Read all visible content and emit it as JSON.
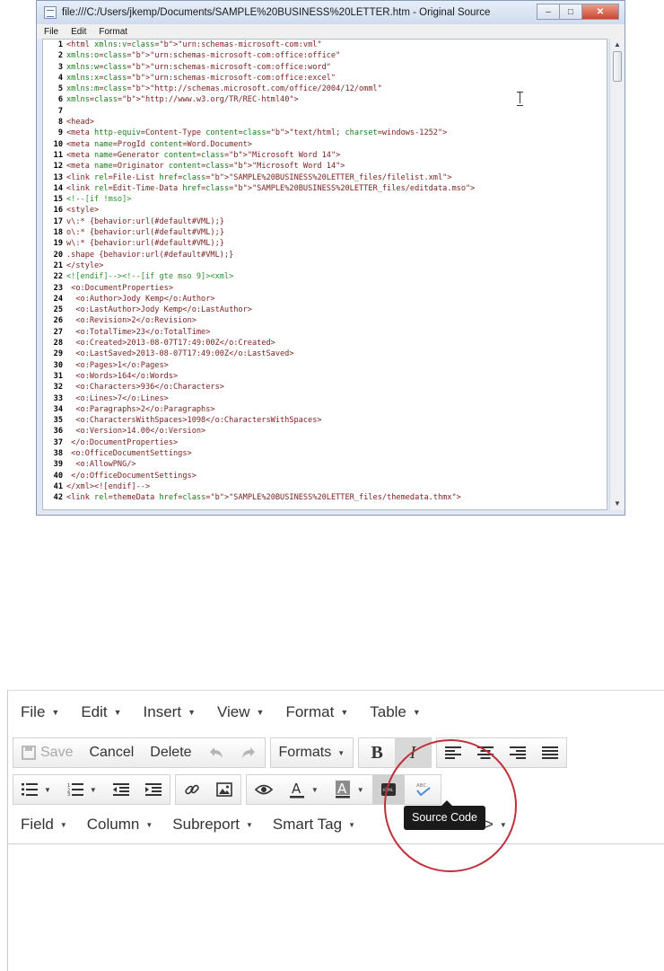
{
  "source_window": {
    "title": "file:///C:/Users/jkemp/Documents/SAMPLE%20BUSINESS%20LETTER.htm - Original Source",
    "menu": [
      "File",
      "Edit",
      "Format"
    ],
    "controls": {
      "minimize": "–",
      "maximize": "□",
      "close": "✕"
    },
    "lines": [
      {
        "n": "1",
        "t": "<html xmlns:v=\"urn:schemas-microsoft-com:vml\""
      },
      {
        "n": "2",
        "t": "xmlns:o=\"urn:schemas-microsoft-com:office:office\""
      },
      {
        "n": "3",
        "t": "xmlns:w=\"urn:schemas-microsoft-com:office:word\""
      },
      {
        "n": "4",
        "t": "xmlns:x=\"urn:schemas-microsoft-com:office:excel\""
      },
      {
        "n": "5",
        "t": "xmlns:m=\"http://schemas.microsoft.com/office/2004/12/omml\""
      },
      {
        "n": "6",
        "t": "xmlns=\"http://www.w3.org/TR/REC-html40\">"
      },
      {
        "n": "7",
        "t": ""
      },
      {
        "n": "8",
        "t": "<head>"
      },
      {
        "n": "9",
        "t": "<meta http-equiv=Content-Type content=\"text/html; charset=windows-1252\">"
      },
      {
        "n": "10",
        "t": "<meta name=ProgId content=Word.Document>"
      },
      {
        "n": "11",
        "t": "<meta name=Generator content=\"Microsoft Word 14\">"
      },
      {
        "n": "12",
        "t": "<meta name=Originator content=\"Microsoft Word 14\">"
      },
      {
        "n": "13",
        "t": "<link rel=File-List href=\"SAMPLE%20BUSINESS%20LETTER_files/filelist.xml\">"
      },
      {
        "n": "14",
        "t": "<link rel=Edit-Time-Data href=\"SAMPLE%20BUSINESS%20LETTER_files/editdata.mso\">"
      },
      {
        "n": "15",
        "t": "<!--[if !mso]>"
      },
      {
        "n": "16",
        "t": "<style>"
      },
      {
        "n": "17",
        "t": "v\\:* {behavior:url(#default#VML);}"
      },
      {
        "n": "18",
        "t": "o\\:* {behavior:url(#default#VML);}"
      },
      {
        "n": "19",
        "t": "w\\:* {behavior:url(#default#VML);}"
      },
      {
        "n": "20",
        "t": ".shape {behavior:url(#default#VML);}"
      },
      {
        "n": "21",
        "t": "</style>"
      },
      {
        "n": "22",
        "t": "<![endif]--><!--[if gte mso 9]><xml>"
      },
      {
        "n": "23",
        "t": " <o:DocumentProperties>"
      },
      {
        "n": "24",
        "t": "  <o:Author>Jody Kemp</o:Author>"
      },
      {
        "n": "25",
        "t": "  <o:LastAuthor>Jody Kemp</o:LastAuthor>"
      },
      {
        "n": "26",
        "t": "  <o:Revision>2</o:Revision>"
      },
      {
        "n": "27",
        "t": "  <o:TotalTime>23</o:TotalTime>"
      },
      {
        "n": "28",
        "t": "  <o:Created>2013-08-07T17:49:00Z</o:Created>"
      },
      {
        "n": "29",
        "t": "  <o:LastSaved>2013-08-07T17:49:00Z</o:LastSaved>"
      },
      {
        "n": "30",
        "t": "  <o:Pages>1</o:Pages>"
      },
      {
        "n": "31",
        "t": "  <o:Words>164</o:Words>"
      },
      {
        "n": "32",
        "t": "  <o:Characters>936</o:Characters>"
      },
      {
        "n": "33",
        "t": "  <o:Lines>7</o:Lines>"
      },
      {
        "n": "34",
        "t": "  <o:Paragraphs>2</o:Paragraphs>"
      },
      {
        "n": "35",
        "t": "  <o:CharactersWithSpaces>1098</o:CharactersWithSpaces>"
      },
      {
        "n": "36",
        "t": "  <o:Version>14.00</o:Version>"
      },
      {
        "n": "37",
        "t": " </o:DocumentProperties>"
      },
      {
        "n": "38",
        "t": " <o:OfficeDocumentSettings>"
      },
      {
        "n": "39",
        "t": "  <o:AllowPNG/>"
      },
      {
        "n": "40",
        "t": " </o:OfficeDocumentSettings>"
      },
      {
        "n": "41",
        "t": "</xml><![endif]-->"
      },
      {
        "n": "42",
        "t": "<link rel=themeData href=\"SAMPLE%20BUSINESS%20LETTER_files/themedata.thmx\">"
      }
    ]
  },
  "editor": {
    "menu": [
      {
        "label": "File",
        "caret": "▼"
      },
      {
        "label": "Edit",
        "caret": "▼"
      },
      {
        "label": "Insert",
        "caret": "▼"
      },
      {
        "label": "View",
        "caret": "▼"
      },
      {
        "label": "Format",
        "caret": "▼"
      },
      {
        "label": "Table",
        "caret": "▼"
      }
    ],
    "row1": {
      "save_label": "Save",
      "cancel_label": "Cancel",
      "delete_label": "Delete",
      "formats_label": "Formats",
      "bold_label": "B",
      "italic_label": "I"
    },
    "row3": {
      "field_label": "Field",
      "column_label": "Column",
      "subreport_label": "Subreport",
      "smart_tag_label": "Smart Tag",
      "code_label": "<>"
    },
    "tooltip": "Source Code",
    "icons": {
      "save": "floppy-disk-icon",
      "undo": "undo-icon",
      "redo": "redo-icon",
      "source_code": "html-source-icon",
      "spellcheck": "spellcheck-icon"
    },
    "colors": {
      "highlight_circle": "#c0303a",
      "tooltip_bg": "#1a1a1a"
    }
  }
}
